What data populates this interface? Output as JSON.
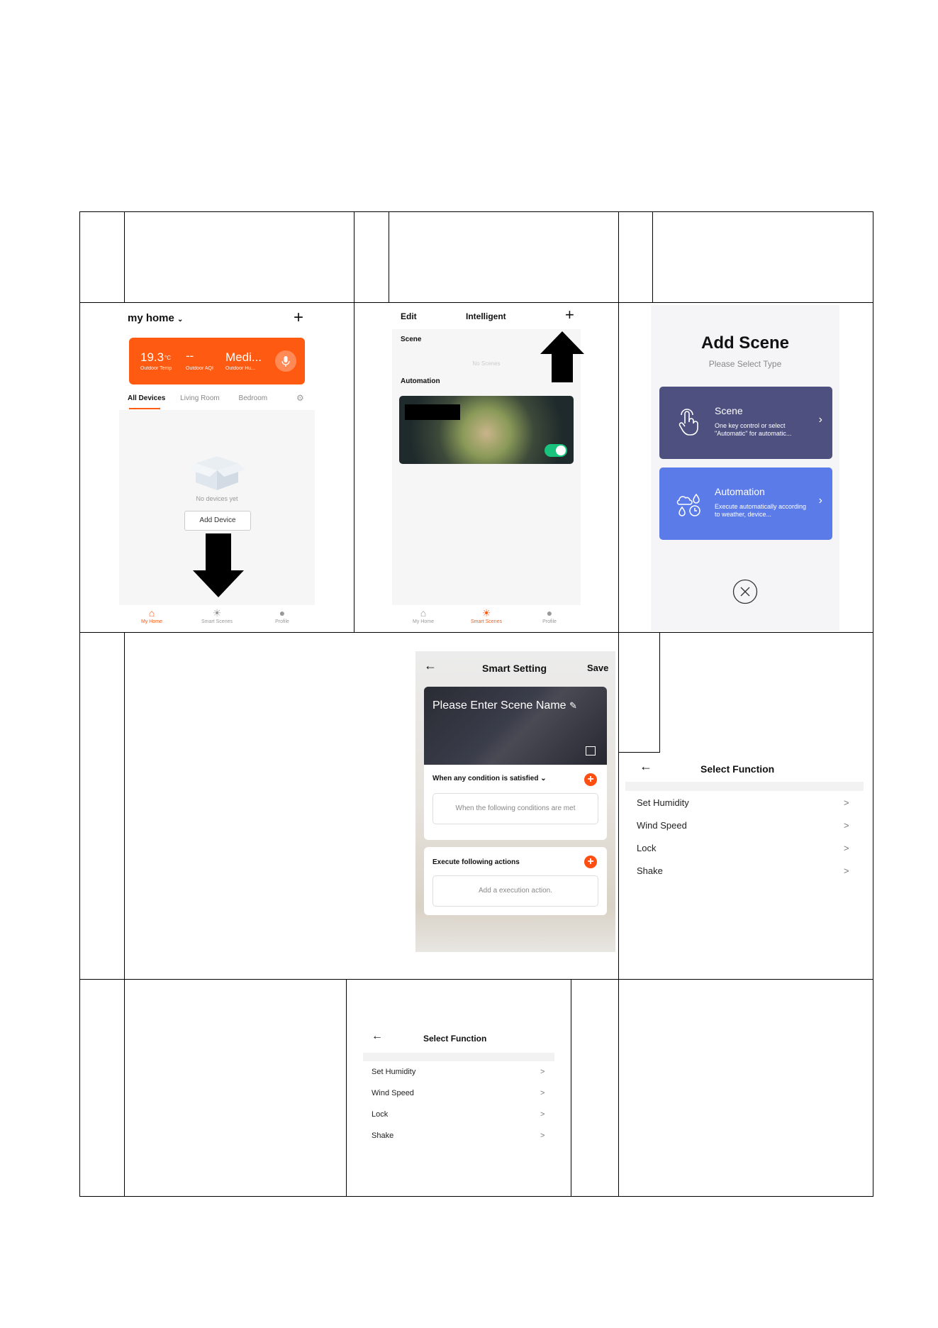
{
  "screen1": {
    "home_title": "my home",
    "plus": "+",
    "weather": {
      "temp": "19.3",
      "temp_unit": "°C",
      "temp_label": "Outdoor Temp",
      "aqi": "--",
      "aqi_label": "Outdoor AQI",
      "humidity": "Medi...",
      "humidity_label": "Outdoor Hu..."
    },
    "tabs": [
      "All Devices",
      "Living Room",
      "Bedroom"
    ],
    "empty_text": "No devices yet",
    "add_device": "Add Device",
    "nav": [
      "My Home",
      "Smart Scenes",
      "Profile"
    ]
  },
  "screen2": {
    "edit": "Edit",
    "title": "Intelligent",
    "plus": "+",
    "scene_label": "Scene",
    "no_scenes": "No Scenes",
    "automation_label": "Automation",
    "nav": [
      "My Home",
      "Smart Scenes",
      "Profile"
    ]
  },
  "screen3": {
    "title": "Add Scene",
    "subtitle": "Please Select Type",
    "scene_card": {
      "title": "Scene",
      "desc": "One key control or select \"Automatic\" for automatic...",
      "color": "#4e5180"
    },
    "automation_card": {
      "title": "Automation",
      "desc": "Execute automatically according to weather, device...",
      "color": "#5b7be9"
    }
  },
  "screen4": {
    "title": "Smart Setting",
    "save": "Save",
    "scene_name": "Please Enter Scene Name",
    "condition_title": "When any condition is satisfied",
    "condition_placeholder": "When the following conditions are met",
    "actions_title": "Execute following actions",
    "actions_placeholder": "Add a execution action."
  },
  "select_function_right": {
    "title": "Select Function",
    "items": [
      "Set Humidity",
      "Wind Speed",
      "Lock",
      "Shake"
    ]
  },
  "select_function_bottom": {
    "title": "Select Function",
    "items": [
      "Set Humidity",
      "Wind Speed",
      "Lock",
      "Shake"
    ]
  },
  "colors": {
    "accent_orange": "#ff5a11",
    "toggle_green": "#19c37d"
  }
}
